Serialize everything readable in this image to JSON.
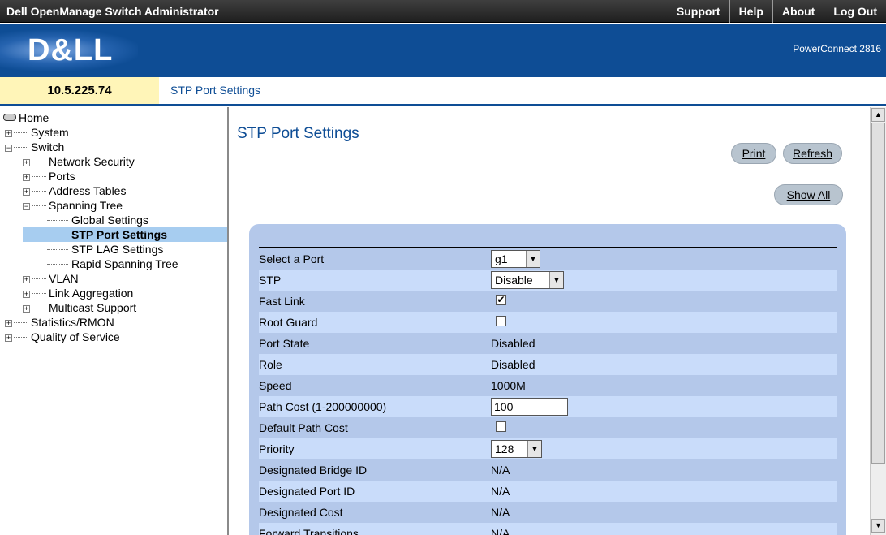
{
  "window": {
    "app_title": "Dell OpenManage Switch Administrator"
  },
  "topnav": {
    "support": "Support",
    "help": "Help",
    "about": "About",
    "logout": "Log Out"
  },
  "brand": {
    "logo": "D&LL",
    "model": "PowerConnect 2816"
  },
  "ipbar": {
    "ip": "10.5.225.74",
    "breadcrumb": "STP Port Settings"
  },
  "tree": {
    "home": "Home",
    "system": "System",
    "switch": "Switch",
    "network_security": "Network Security",
    "ports": "Ports",
    "address_tables": "Address Tables",
    "spanning_tree": "Spanning Tree",
    "global_settings": "Global Settings",
    "stp_port_settings": "STP Port Settings",
    "stp_lag_settings": "STP LAG Settings",
    "rapid_spanning_tree": "Rapid Spanning Tree",
    "vlan": "VLAN",
    "link_aggregation": "Link Aggregation",
    "multicast_support": "Multicast Support",
    "statistics_rmon": "Statistics/RMON",
    "quality_of_service": "Quality of Service"
  },
  "main": {
    "title": "STP Port Settings",
    "print": "Print",
    "refresh": "Refresh",
    "show_all": "Show All"
  },
  "form": {
    "select_port": {
      "label": "Select a Port",
      "value": "g1"
    },
    "stp": {
      "label": "STP",
      "value": "Disable"
    },
    "fast_link": {
      "label": "Fast Link",
      "checked": "✔"
    },
    "root_guard": {
      "label": "Root Guard",
      "checked": ""
    },
    "port_state": {
      "label": "Port State",
      "value": "Disabled"
    },
    "role": {
      "label": "Role",
      "value": "Disabled"
    },
    "speed": {
      "label": "Speed",
      "value": "1000M"
    },
    "path_cost": {
      "label": "Path Cost (1-200000000)",
      "value": "100"
    },
    "default_path_cost": {
      "label": "Default Path Cost",
      "checked": ""
    },
    "priority": {
      "label": "Priority",
      "value": "128"
    },
    "designated_bridge_id": {
      "label": "Designated Bridge ID",
      "value": "N/A"
    },
    "designated_port_id": {
      "label": "Designated Port ID",
      "value": "N/A"
    },
    "designated_cost": {
      "label": "Designated Cost",
      "value": "N/A"
    },
    "forward_transitions": {
      "label": "Forward Transitions",
      "value": "N/A"
    }
  },
  "colors": {
    "dell_blue": "#0e4d95",
    "panel": "#b4c8ea",
    "ip_bg": "#fff5b8",
    "selected_tree": "#a7cdf0"
  }
}
